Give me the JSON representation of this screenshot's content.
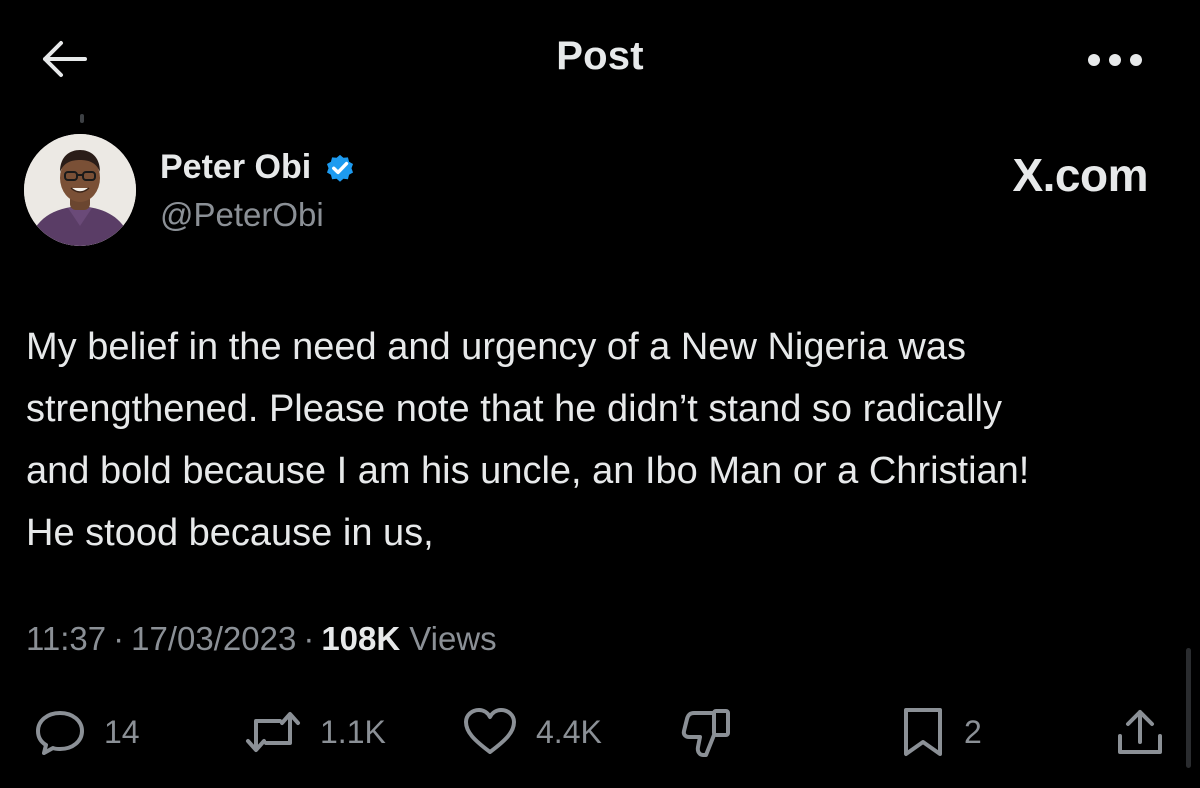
{
  "header": {
    "title": "Post",
    "back_icon": "arrow-left-icon",
    "more_icon": "more-horizontal-icon"
  },
  "author": {
    "name": "Peter Obi",
    "handle": "@PeterObi",
    "verified": true,
    "verified_color": "#1d9bf0"
  },
  "brand": {
    "label": "X.com"
  },
  "post": {
    "text": "My belief in the need and urgency of a New Nigeria was\nstrengthened. Please note that he didn’t stand so radically\nand bold because I am his uncle, an Ibo Man or a Christian!\nHe stood because in us,",
    "time": "11:37",
    "date": "17/03/2023",
    "views_count": "108K",
    "views_label": "Views"
  },
  "actions": {
    "reply": {
      "icon": "reply-icon",
      "count": "14"
    },
    "repost": {
      "icon": "repost-icon",
      "count": "1.1K"
    },
    "like": {
      "icon": "heart-icon",
      "count": "4.4K"
    },
    "downvote": {
      "icon": "thumbs-down-icon"
    },
    "bookmark": {
      "icon": "bookmark-icon",
      "count": "2"
    },
    "share": {
      "icon": "share-icon"
    }
  },
  "colors": {
    "background": "#000000",
    "primary_text": "#e7e9ea",
    "secondary_text": "#8b9096",
    "verified_blue": "#1d9bf0"
  }
}
